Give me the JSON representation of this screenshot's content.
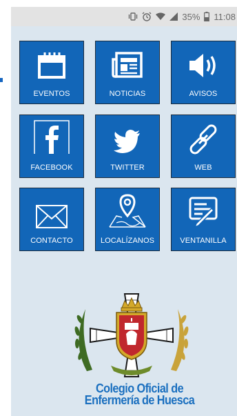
{
  "status_bar": {
    "battery_percent": "35%",
    "time": "11:08",
    "icons": [
      "vibrate-icon",
      "alarm-icon",
      "wifi-icon",
      "signal-icon",
      "battery-icon"
    ]
  },
  "tiles": [
    {
      "label": "EVENTOS",
      "icon": "calendar-icon"
    },
    {
      "label": "NOTICIAS",
      "icon": "newspaper-icon"
    },
    {
      "label": "AVISOS",
      "icon": "speaker-icon"
    },
    {
      "label": "FACEBOOK",
      "icon": "facebook-icon"
    },
    {
      "label": "TWITTER",
      "icon": "twitter-icon"
    },
    {
      "label": "WEB",
      "icon": "link-icon"
    },
    {
      "label": "CONTACTO",
      "icon": "envelope-icon"
    },
    {
      "label": "LOCALÍZANOS",
      "icon": "map-pin-icon"
    },
    {
      "label": "VENTANILLA",
      "icon": "form-pen-icon"
    }
  ],
  "logo": {
    "line1": "Colegio Oficial de",
    "line2": "Enfermería de Huesca"
  },
  "colors": {
    "tile_blue": "#1266b8",
    "background": "#dbe6ef",
    "text_blue": "#1a6fbf"
  }
}
